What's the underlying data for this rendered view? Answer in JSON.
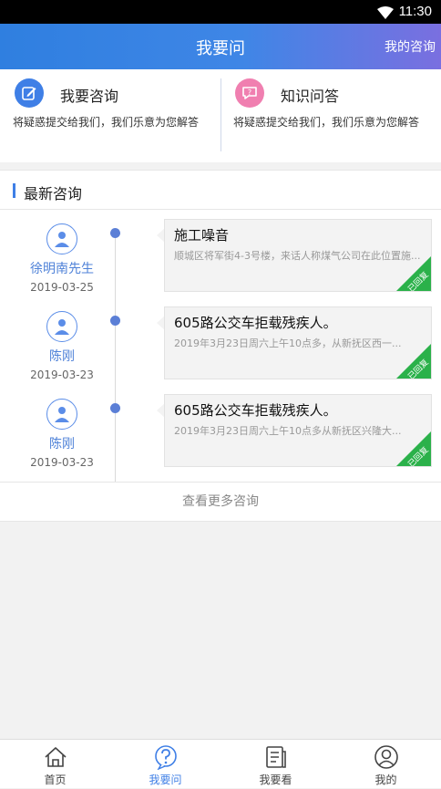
{
  "status_bar": {
    "time": "11:30"
  },
  "header": {
    "title": "我要问",
    "right_link": "我的咨询"
  },
  "cards": [
    {
      "title": "我要咨询",
      "desc": "将疑惑提交给我们，我们乐意为您解答",
      "icon": "edit-icon",
      "color": "#3f7fe6"
    },
    {
      "title": "知识问答",
      "desc": "将疑惑提交给我们，我们乐意为您解答",
      "icon": "chat-icon",
      "color": "#f07fb0"
    }
  ],
  "section": {
    "title": "最新咨询"
  },
  "consultations": [
    {
      "name": "徐明南先生",
      "date": "2019-03-25",
      "title": "施工噪音",
      "desc": "顺城区将军街4-3号楼，来话人称煤气公司在此位置施...",
      "badge": "已回复"
    },
    {
      "name": "陈刚",
      "date": "2019-03-23",
      "title": "605路公交车拒载残疾人。",
      "desc": "2019年3月23日周六上午10点多，从新抚区西一...",
      "badge": "已回复"
    },
    {
      "name": "陈刚",
      "date": "2019-03-23",
      "title": "605路公交车拒载残疾人。",
      "desc": "2019年3月23日周六上午10点多从新抚区兴隆大...",
      "badge": "已回复"
    }
  ],
  "more_link": "查看更多咨询",
  "tabbar": [
    {
      "label": "首页",
      "icon": "home-icon"
    },
    {
      "label": "我要问",
      "icon": "question-icon",
      "active": true
    },
    {
      "label": "我要看",
      "icon": "document-icon"
    },
    {
      "label": "我的",
      "icon": "user-icon"
    }
  ],
  "colors": {
    "accent": "#3f7fe6",
    "badge": "#2bb14a"
  }
}
